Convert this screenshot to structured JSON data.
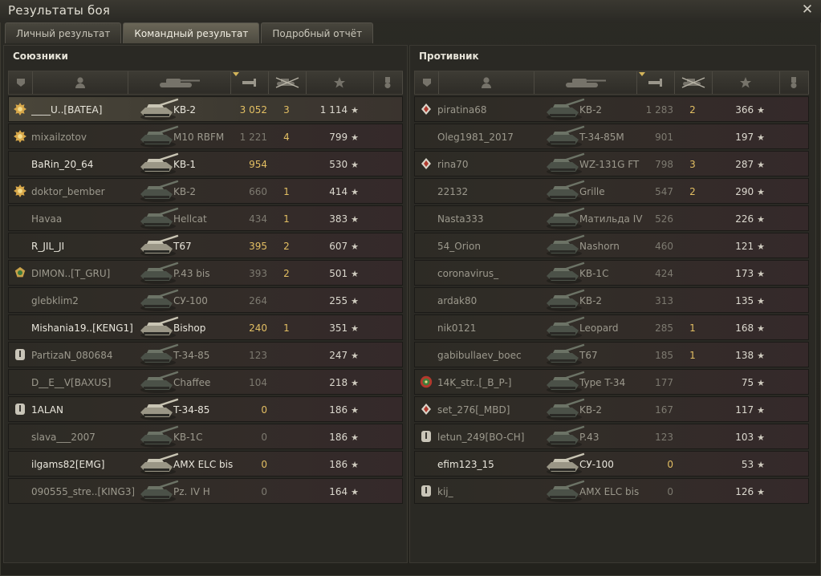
{
  "window": {
    "title": "Результаты боя",
    "close_icon": "close-icon"
  },
  "tabs": [
    {
      "label": "Личный результат",
      "active": false
    },
    {
      "label": "Командный результат",
      "active": true
    },
    {
      "label": "Подробный отчёт",
      "active": false
    }
  ],
  "header_icons": [
    "platoon-icon",
    "player-icon",
    "tank-icon",
    "damage-icon",
    "frags-icon",
    "xp-star-icon",
    "medal-icon"
  ],
  "colors": {
    "gold": "#e3bf63",
    "accent_tab": "#6a6657"
  },
  "allies": {
    "title": "Союзники",
    "rows": [
      {
        "badge": "gold-medal",
        "name": "____U..[BATEA]",
        "vehicle": "KB-2",
        "damage": "3 052",
        "kills": "3",
        "xp": "1 114",
        "highlight": true,
        "name_style": "white",
        "dmg_style": "gold",
        "kills_style": "gold"
      },
      {
        "badge": "gold-medal",
        "name": "mixailzotov",
        "vehicle": "M10 RBFM",
        "damage": "1 221",
        "kills": "4",
        "xp": "799",
        "highlight": false,
        "name_style": "dim",
        "dmg_style": "gray",
        "kills_style": "gold"
      },
      {
        "badge": "",
        "name": "BaRin_20_64",
        "vehicle": "KB-1",
        "damage": "954",
        "kills": "",
        "xp": "530",
        "highlight": false,
        "name_style": "white",
        "dmg_style": "gold",
        "kills_style": "gold"
      },
      {
        "badge": "gold-medal",
        "name": "doktor_bember",
        "vehicle": "KB-2",
        "damage": "660",
        "kills": "1",
        "xp": "414",
        "highlight": false,
        "name_style": "dim",
        "dmg_style": "gray",
        "kills_style": "gold"
      },
      {
        "badge": "",
        "name": "Havaa",
        "vehicle": "Hellcat",
        "damage": "434",
        "kills": "1",
        "xp": "383",
        "highlight": false,
        "name_style": "dim",
        "dmg_style": "gray",
        "kills_style": "gold"
      },
      {
        "badge": "",
        "name": "R_JIL_JI",
        "vehicle": "T67",
        "damage": "395",
        "kills": "2",
        "xp": "607",
        "highlight": false,
        "name_style": "white",
        "dmg_style": "gold",
        "kills_style": "gold"
      },
      {
        "badge": "green-medal",
        "name": "DIMON..[T_GRU]",
        "vehicle": "P.43 bis",
        "damage": "393",
        "kills": "2",
        "xp": "501",
        "highlight": false,
        "name_style": "dim",
        "dmg_style": "gray",
        "kills_style": "gold"
      },
      {
        "badge": "",
        "name": "glebklim2",
        "vehicle": "СУ-100",
        "damage": "264",
        "kills": "",
        "xp": "255",
        "highlight": false,
        "name_style": "dim",
        "dmg_style": "gray",
        "kills_style": "gold"
      },
      {
        "badge": "",
        "name": "Mishania19..[KENG1]",
        "vehicle": "Bishop",
        "damage": "240",
        "kills": "1",
        "xp": "351",
        "highlight": false,
        "name_style": "white",
        "dmg_style": "gold",
        "kills_style": "gold"
      },
      {
        "badge": "shield",
        "name": "PartizaN_080684",
        "vehicle": "T-34-85",
        "damage": "123",
        "kills": "",
        "xp": "247",
        "highlight": false,
        "name_style": "dim",
        "dmg_style": "gray",
        "kills_style": "gold"
      },
      {
        "badge": "",
        "name": "D__E__V[BAXUS]",
        "vehicle": "Chaffee",
        "damage": "104",
        "kills": "",
        "xp": "218",
        "highlight": false,
        "name_style": "dim",
        "dmg_style": "gray",
        "kills_style": "gold"
      },
      {
        "badge": "shield",
        "name": "1ALAN",
        "vehicle": "T-34-85",
        "damage": "0",
        "kills": "",
        "xp": "186",
        "highlight": false,
        "name_style": "white",
        "dmg_style": "gold",
        "kills_style": "gold"
      },
      {
        "badge": "",
        "name": "slava___2007",
        "vehicle": "KB-1C",
        "damage": "0",
        "kills": "",
        "xp": "186",
        "highlight": false,
        "name_style": "dim",
        "dmg_style": "gray",
        "kills_style": "gold"
      },
      {
        "badge": "",
        "name": "ilgams82[EMG]",
        "vehicle": "AMX ELC bis",
        "damage": "0",
        "kills": "",
        "xp": "186",
        "highlight": false,
        "name_style": "white",
        "dmg_style": "gold",
        "kills_style": "gold"
      },
      {
        "badge": "",
        "name": "090555_stre..[KING3]",
        "vehicle": "Pz. IV H",
        "damage": "0",
        "kills": "",
        "xp": "164",
        "highlight": false,
        "name_style": "dim",
        "dmg_style": "gray",
        "kills_style": "gold"
      }
    ]
  },
  "enemies": {
    "title": "Противник",
    "rows": [
      {
        "badge": "red-diamond",
        "name": "piratina68",
        "vehicle": "KB-2",
        "damage": "1 283",
        "kills": "2",
        "xp": "366",
        "highlight": false,
        "name_style": "dim",
        "dmg_style": "gray",
        "kills_style": "gold"
      },
      {
        "badge": "",
        "name": "Oleg1981_2017",
        "vehicle": "T-34-85M",
        "damage": "901",
        "kills": "",
        "xp": "197",
        "highlight": false,
        "name_style": "dim",
        "dmg_style": "gray",
        "kills_style": "gold"
      },
      {
        "badge": "red-diamond",
        "name": "rina70",
        "vehicle": "WZ-131G FT",
        "damage": "798",
        "kills": "3",
        "xp": "287",
        "highlight": false,
        "name_style": "dim",
        "dmg_style": "gray",
        "kills_style": "gold"
      },
      {
        "badge": "",
        "name": "22132",
        "vehicle": "Grille",
        "damage": "547",
        "kills": "2",
        "xp": "290",
        "highlight": false,
        "name_style": "dim",
        "dmg_style": "gray",
        "kills_style": "gold"
      },
      {
        "badge": "",
        "name": "Nasta333",
        "vehicle": "Матильда IV",
        "damage": "526",
        "kills": "",
        "xp": "226",
        "highlight": false,
        "name_style": "dim",
        "dmg_style": "gray",
        "kills_style": "gold"
      },
      {
        "badge": "",
        "name": "54_Orion",
        "vehicle": "Nashorn",
        "damage": "460",
        "kills": "",
        "xp": "121",
        "highlight": false,
        "name_style": "dim",
        "dmg_style": "gray",
        "kills_style": "gold"
      },
      {
        "badge": "",
        "name": "coronavirus_",
        "vehicle": "KB-1C",
        "damage": "424",
        "kills": "",
        "xp": "173",
        "highlight": false,
        "name_style": "dim",
        "dmg_style": "gray",
        "kills_style": "gold"
      },
      {
        "badge": "",
        "name": "ardak80",
        "vehicle": "KB-2",
        "damage": "313",
        "kills": "",
        "xp": "135",
        "highlight": false,
        "name_style": "dim",
        "dmg_style": "gray",
        "kills_style": "gold"
      },
      {
        "badge": "",
        "name": "nik0121",
        "vehicle": "Leopard",
        "damage": "285",
        "kills": "1",
        "xp": "168",
        "highlight": false,
        "name_style": "dim",
        "dmg_style": "gray",
        "kills_style": "gold"
      },
      {
        "badge": "",
        "name": "gabibullaev_boec",
        "vehicle": "T67",
        "damage": "185",
        "kills": "1",
        "xp": "138",
        "highlight": false,
        "name_style": "dim",
        "dmg_style": "gray",
        "kills_style": "gold"
      },
      {
        "badge": "red-green-medal",
        "name": "14K_str..[_B_P-]",
        "vehicle": "Type T-34",
        "damage": "177",
        "kills": "",
        "xp": "75",
        "highlight": false,
        "name_style": "dim",
        "dmg_style": "gray",
        "kills_style": "gold"
      },
      {
        "badge": "red-diamond",
        "name": "set_276[_MBD]",
        "vehicle": "KB-2",
        "damage": "167",
        "kills": "",
        "xp": "117",
        "highlight": false,
        "name_style": "dim",
        "dmg_style": "gray",
        "kills_style": "gold"
      },
      {
        "badge": "shield",
        "name": "letun_249[BO-CH]",
        "vehicle": "P.43",
        "damage": "123",
        "kills": "",
        "xp": "103",
        "highlight": false,
        "name_style": "dim",
        "dmg_style": "gray",
        "kills_style": "gold"
      },
      {
        "badge": "",
        "name": "efim123_15",
        "vehicle": "СУ-100",
        "damage": "0",
        "kills": "",
        "xp": "53",
        "highlight": false,
        "name_style": "white",
        "dmg_style": "gold",
        "kills_style": "gold"
      },
      {
        "badge": "shield",
        "name": "kij_",
        "vehicle": "AMX ELC bis",
        "damage": "0",
        "kills": "",
        "xp": "126",
        "highlight": false,
        "name_style": "dim",
        "dmg_style": "gray",
        "kills_style": "gold"
      }
    ]
  }
}
